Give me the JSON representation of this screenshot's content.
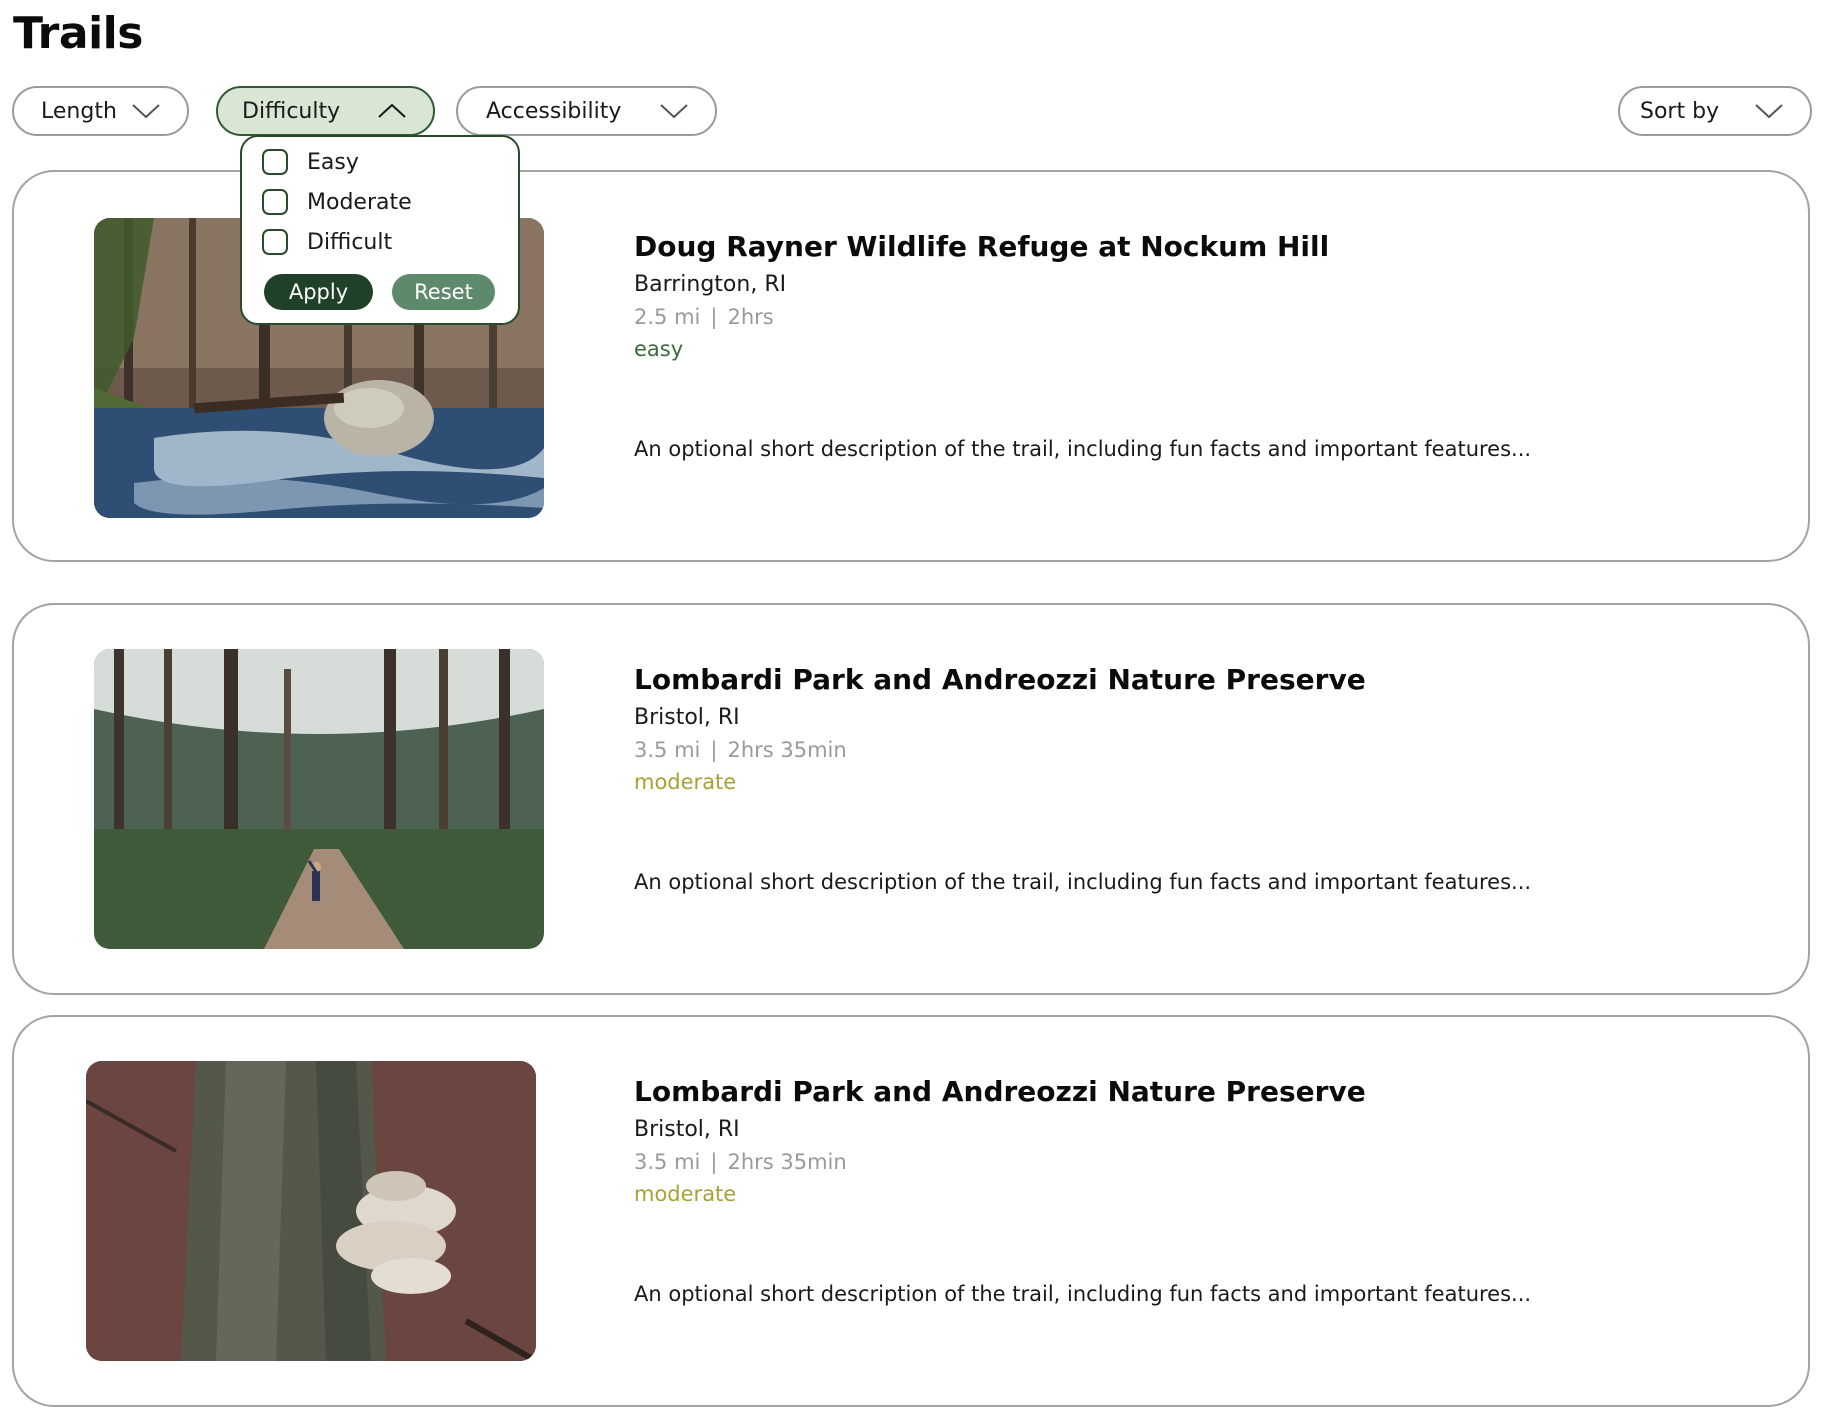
{
  "page": {
    "title": "Trails"
  },
  "filters": {
    "length_label": "Length",
    "difficulty_label": "Difficulty",
    "accessibility_label": "Accessibility",
    "sort_label": "Sort by"
  },
  "difficulty_dropdown": {
    "options": [
      {
        "label": "Easy",
        "checked": false
      },
      {
        "label": "Moderate",
        "checked": false
      },
      {
        "label": "Difficult",
        "checked": false
      }
    ],
    "apply_label": "Apply",
    "reset_label": "Reset"
  },
  "colors": {
    "accent_dark": "#1f4127",
    "accent_muted": "#5e8a6c",
    "active_pill_bg": "#d9e6d4",
    "easy": "#3a6b3a",
    "moderate": "#a8a234",
    "meta_gray": "#9a9a9a"
  },
  "trails": [
    {
      "name": "Doug Rayner Wildlife Refuge at Nockum Hill",
      "location": "Barrington, RI",
      "distance": "2.5 mi",
      "separator": "|",
      "duration": "2hrs",
      "difficulty": "easy",
      "description": "An optional short description of the trail, including fun facts and important features...",
      "image": "stream-with-boulder-photo"
    },
    {
      "name": "Lombardi Park and Andreozzi Nature Preserve",
      "location": "Bristol, RI",
      "distance": "3.5 mi",
      "separator": "|",
      "duration": "2hrs 35min",
      "difficulty": "moderate",
      "description": "An optional short description of the trail, including fun facts and important features...",
      "image": "pine-forest-path-photo"
    },
    {
      "name": "Lombardi Park and Andreozzi Nature Preserve",
      "location": "Bristol, RI",
      "distance": "3.5 mi",
      "separator": "|",
      "duration": "2hrs 35min",
      "difficulty": "moderate",
      "description": "An optional short description of the trail, including fun facts and important features...",
      "image": "tree-fungus-photo"
    }
  ]
}
